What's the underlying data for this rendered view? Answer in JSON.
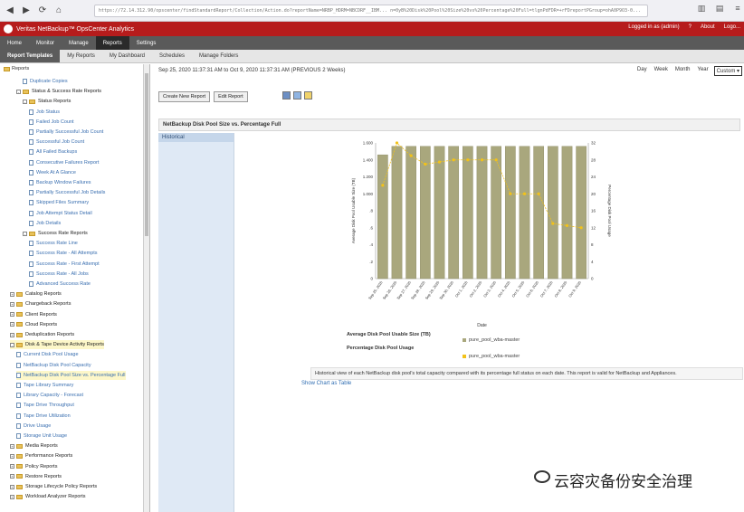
{
  "browser": {
    "url": "https://72.14.312.90/opscenter/findStandardReport/Collection/Action.do?reportName=NRBP_HDRM=NBCDRF__IBM... n=0yB%20Disk%20Pool%20Size%20vs%20Percentage%20Full=tlgnPdFDR=+rFDreportPGroup=ohA0P9O3-0..."
  },
  "app": {
    "title": "Veritas NetBackup™ OpsCenter Analytics",
    "logged_in": "Logged in as (admin)",
    "help": "?",
    "about": "About",
    "logout": "Logo..."
  },
  "main_nav": [
    "Home",
    "Monitor",
    "Manage",
    "Reports",
    "Settings"
  ],
  "sub_nav": [
    "Report Templates",
    "My Reports",
    "My Dashboard",
    "Schedules",
    "Manage Folders"
  ],
  "tree": {
    "root": "Reports",
    "items": [
      {
        "label": "Duplicate Copies",
        "type": "report",
        "indent": 3
      },
      {
        "label": "Status & Success Rate Reports",
        "type": "folder",
        "indent": 2,
        "exp": "-"
      },
      {
        "label": "Status Reports",
        "type": "folder",
        "indent": 3,
        "exp": "-"
      },
      {
        "label": "Job Status",
        "type": "report",
        "indent": 4
      },
      {
        "label": "Failed Job Count",
        "type": "report",
        "indent": 4
      },
      {
        "label": "Partially Successful Job Count",
        "type": "report",
        "indent": 4
      },
      {
        "label": "Successful Job Count",
        "type": "report",
        "indent": 4
      },
      {
        "label": "All Failed Backups",
        "type": "report",
        "indent": 4
      },
      {
        "label": "Consecutive Failures Report",
        "type": "report",
        "indent": 4
      },
      {
        "label": "Week At A Glance",
        "type": "report",
        "indent": 4
      },
      {
        "label": "Backup Window Failures",
        "type": "report",
        "indent": 4
      },
      {
        "label": "Partially Successful Job Details",
        "type": "report",
        "indent": 4
      },
      {
        "label": "Skipped Files Summary",
        "type": "report",
        "indent": 4
      },
      {
        "label": "Job Attempt Status Detail",
        "type": "report",
        "indent": 4
      },
      {
        "label": "Job Details",
        "type": "report",
        "indent": 4
      },
      {
        "label": "Success Rate Reports",
        "type": "folder",
        "indent": 3,
        "exp": "-"
      },
      {
        "label": "Success Rate Line",
        "type": "report",
        "indent": 4
      },
      {
        "label": "Success Rate - All Attempts",
        "type": "report",
        "indent": 4
      },
      {
        "label": "Success Rate - First Attempt",
        "type": "report",
        "indent": 4
      },
      {
        "label": "Success Rate - All Jobs",
        "type": "report",
        "indent": 4
      },
      {
        "label": "Advanced Success Rate",
        "type": "report",
        "indent": 4
      },
      {
        "label": "Catalog Reports",
        "type": "folder",
        "indent": 1,
        "exp": "+"
      },
      {
        "label": "Chargeback Reports",
        "type": "folder",
        "indent": 1,
        "exp": "+"
      },
      {
        "label": "Client Reports",
        "type": "folder",
        "indent": 1,
        "exp": "+"
      },
      {
        "label": "Cloud Reports",
        "type": "folder",
        "indent": 1,
        "exp": "+"
      },
      {
        "label": "Deduplication Reports",
        "type": "folder",
        "indent": 1,
        "exp": "+"
      },
      {
        "label": "Disk & Tape Device Activity Reports",
        "type": "folder",
        "indent": 1,
        "exp": "-",
        "highlight": true
      },
      {
        "label": "Current Disk Pool Usage",
        "type": "report",
        "indent": 2
      },
      {
        "label": "NetBackup Disk Pool Capacity",
        "type": "report",
        "indent": 2
      },
      {
        "label": "NetBackup Disk Pool Size vs. Percentage Full",
        "type": "report",
        "indent": 2,
        "highlight": true
      },
      {
        "label": "Tape Library Summary",
        "type": "report",
        "indent": 2
      },
      {
        "label": "Library Capacity - Forecast",
        "type": "report",
        "indent": 2
      },
      {
        "label": "Tape Drive Throughput",
        "type": "report",
        "indent": 2
      },
      {
        "label": "Tape Drive Utilization",
        "type": "report",
        "indent": 2
      },
      {
        "label": "Drive Usage",
        "type": "report",
        "indent": 2
      },
      {
        "label": "Storage Unit Usage",
        "type": "report",
        "indent": 2
      },
      {
        "label": "Media Reports",
        "type": "folder",
        "indent": 1,
        "exp": "+"
      },
      {
        "label": "Performance Reports",
        "type": "folder",
        "indent": 1,
        "exp": "+"
      },
      {
        "label": "Policy Reports",
        "type": "folder",
        "indent": 1,
        "exp": "+"
      },
      {
        "label": "Restore Reports",
        "type": "folder",
        "indent": 1,
        "exp": "+"
      },
      {
        "label": "Storage Lifecycle Policy Reports",
        "type": "folder",
        "indent": 1,
        "exp": "+"
      },
      {
        "label": "Workload Analyzer Reports",
        "type": "folder",
        "indent": 1,
        "exp": "+"
      }
    ]
  },
  "content": {
    "date_range": "Sep 25, 2020 11:37:31 AM to Oct 9, 2020 11:37:31 AM (PREVIOUS 2 Weeks)",
    "period_tabs": [
      "Day",
      "Week",
      "Month",
      "Year",
      "Custom ▾"
    ],
    "buttons": {
      "create": "Create New Report",
      "edit": "Edit Report"
    },
    "report_title": "NetBackup Disk Pool Size vs. Percentage Full",
    "left_tab": "Historical",
    "legend_title_1": "Average Disk Pool Usable Size (TB)",
    "legend_title_2": "Percentage Disk Pool Usage",
    "legend_entry_1": "pure_pool_wba-master",
    "legend_entry_2": "pure_pool_wba-master",
    "description": "Historical view of each NetBackup disk pool's total capacity compared with its percentage full status on each date. This report is valid for NetBackup and Appliances.",
    "show_link": "Show Chart as Table"
  },
  "colors": {
    "header_red": "#b61c1c",
    "bar_fill": "#a9a77d",
    "line": "#f2c21a",
    "link": "#2f6db2"
  },
  "chart_data": {
    "type": "bar",
    "title": "",
    "xlabel": "Date",
    "ylabel": "Average Disk Pool Usable Size (TB)",
    "y2label": "Percentage Disk Pool Usage",
    "ylim": [
      0,
      1.6
    ],
    "y2lim": [
      0,
      32
    ],
    "yticks": [
      "0",
      ".2",
      ".4",
      ".6",
      ".8",
      "1.000",
      "1.200",
      "1.400",
      "1.600"
    ],
    "y2ticks": [
      "0",
      "4",
      "8",
      "12",
      "16",
      "20",
      "24",
      "28",
      "32"
    ],
    "categories": [
      "Sep 25, 2020",
      "Sep 26, 2020",
      "Sep 27, 2020",
      "Sep 28, 2020",
      "Sep 29, 2020",
      "Sep 30, 2020",
      "Oct 1, 2020",
      "Oct 2, 2020",
      "Oct 3, 2020",
      "Oct 4, 2020",
      "Oct 5, 2020",
      "Oct 6, 2020",
      "Oct 7, 2020",
      "Oct 8, 2020",
      "Oct 9, 2020"
    ],
    "series": [
      {
        "name": "pure_pool_wba-master",
        "kind": "bar",
        "values": [
          1.46,
          1.56,
          1.56,
          1.56,
          1.56,
          1.56,
          1.56,
          1.56,
          1.56,
          1.56,
          1.56,
          1.56,
          1.56,
          1.56,
          1.56
        ]
      },
      {
        "name": "pure_pool_wba-master",
        "kind": "line",
        "values": [
          22,
          32,
          29,
          27,
          27.5,
          28,
          28,
          28,
          28,
          20,
          20,
          20,
          13,
          12.5,
          12
        ]
      }
    ],
    "grid": false,
    "legend": "bottom"
  }
}
